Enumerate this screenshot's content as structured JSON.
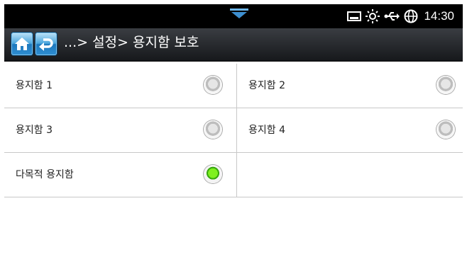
{
  "status_bar": {
    "icons": [
      "tray-icon",
      "sun-icon",
      "usb-icon",
      "globe-icon"
    ],
    "time": "14:30"
  },
  "title_bar": {
    "breadcrumb": "...> 설정> 용지함 보호"
  },
  "options": [
    {
      "label": "용지함 1",
      "selected": false
    },
    {
      "label": "용지함 2",
      "selected": false
    },
    {
      "label": "용지함 3",
      "selected": false
    },
    {
      "label": "용지함 4",
      "selected": false
    },
    {
      "label": "다목적 용지함",
      "selected": true
    }
  ],
  "colors": {
    "accent": "#2f8fd2",
    "selected": "#5bd31a"
  }
}
